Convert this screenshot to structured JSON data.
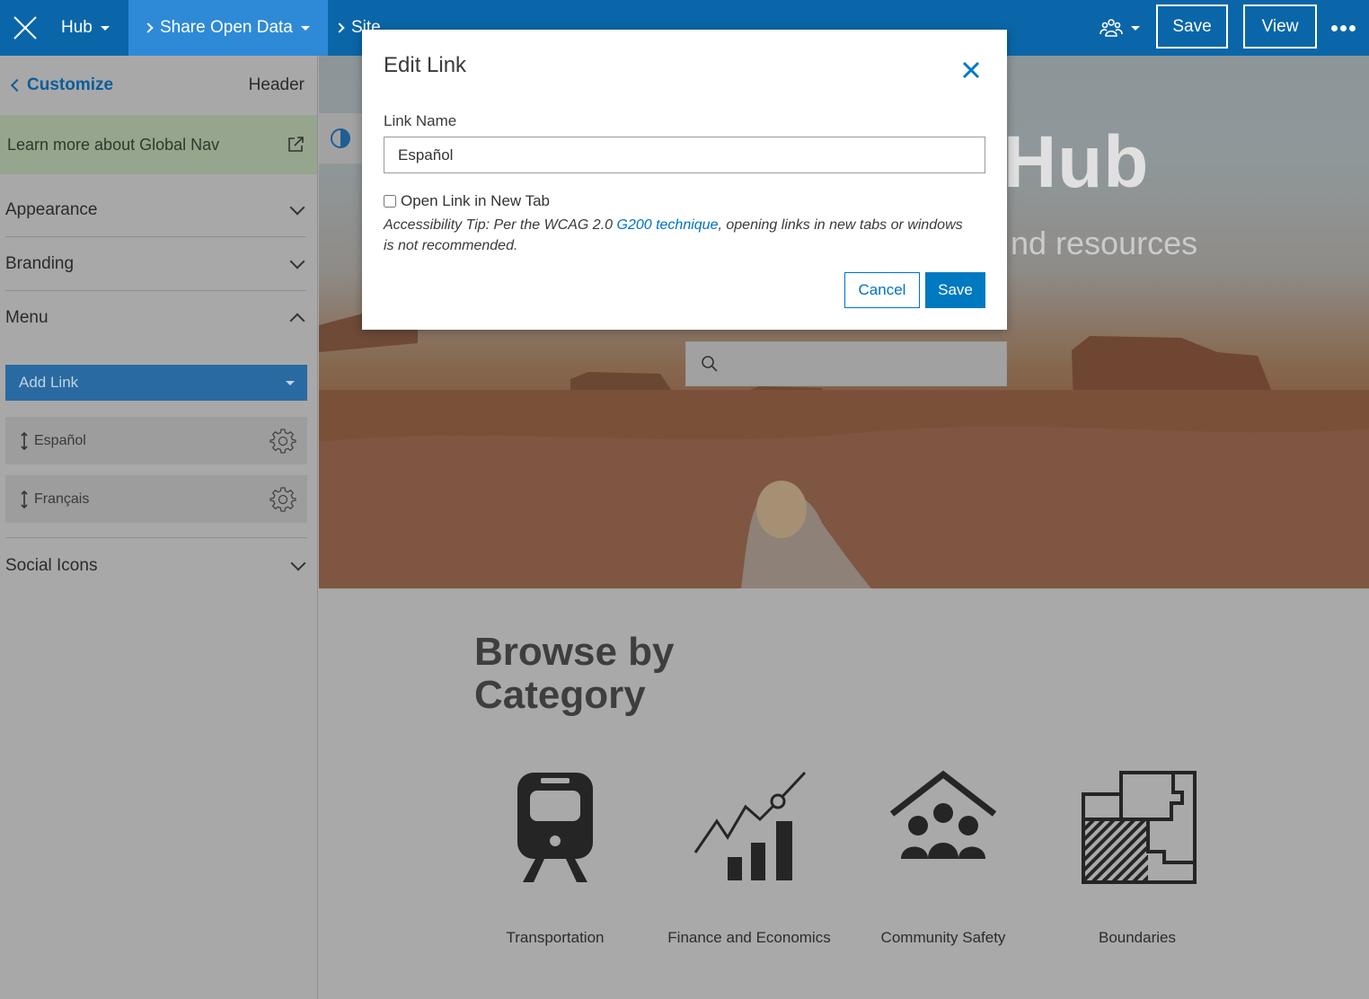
{
  "topbar": {
    "hub_label": "Hub",
    "share_label": "Share Open Data",
    "site_label": "Site",
    "save_label": "Save",
    "view_label": "View"
  },
  "sidebar": {
    "back_label": "Customize",
    "title": "Header",
    "learn_label": "Learn more about Global Nav",
    "sections": {
      "appearance": "Appearance",
      "branding": "Branding",
      "menu": "Menu",
      "social": "Social Icons"
    },
    "add_link_label": "Add Link",
    "menu_items": [
      {
        "label": "Español"
      },
      {
        "label": "Français"
      }
    ]
  },
  "hero": {
    "title_fragment": "Hub",
    "subtitle_fragment": "nd resources"
  },
  "browse": {
    "heading_line1": "Browse by",
    "heading_line2": "Category",
    "categories": [
      {
        "label": "Transportation",
        "icon": "train-icon"
      },
      {
        "label": "Finance and Economics",
        "icon": "chart-icon"
      },
      {
        "label": "Community Safety",
        "icon": "community-icon"
      },
      {
        "label": "Boundaries",
        "icon": "boundaries-icon"
      }
    ]
  },
  "modal": {
    "title": "Edit Link",
    "field_label": "Link Name",
    "field_value": "Español",
    "checkbox_label": "Open Link in New Tab",
    "checkbox_checked": false,
    "tip_prefix": "Accessibility Tip: Per the WCAG 2.0 ",
    "tip_link": "G200 technique",
    "tip_suffix": ", opening links in new tabs or windows is not recommended.",
    "cancel_label": "Cancel",
    "save_label": "Save"
  },
  "colors": {
    "topbar": "#0a66a8",
    "active_tab": "#2e8ad6",
    "primary_button": "#0079c1",
    "link": "#0072c6"
  }
}
